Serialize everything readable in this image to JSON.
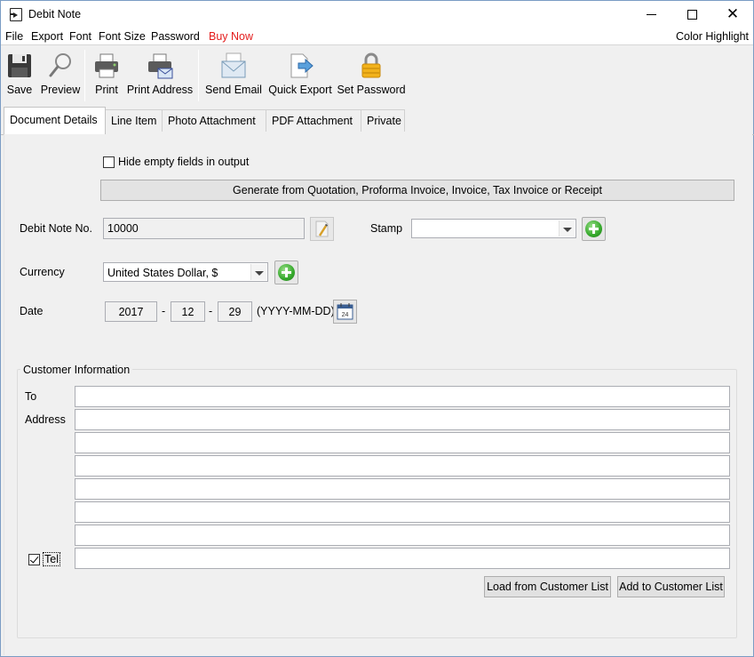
{
  "window": {
    "title": "Debit Note"
  },
  "menu": {
    "file": "File",
    "export": "Export",
    "font": "Font",
    "font_size": "Font Size",
    "password": "Password",
    "buy_now": "Buy Now",
    "color_highlight": "Color Highlight"
  },
  "toolbar": {
    "save": "Save",
    "preview": "Preview",
    "print": "Print",
    "print_address": "Print Address",
    "send_email": "Send Email",
    "quick_export": "Quick Export",
    "set_password": "Set Password"
  },
  "tabs": [
    {
      "label": "Document Details",
      "active": true
    },
    {
      "label": "Line Item"
    },
    {
      "label": "Photo Attachment"
    },
    {
      "label": "PDF Attachment"
    },
    {
      "label": "Private"
    }
  ],
  "form": {
    "hide_empty_label": "Hide empty fields in output",
    "generate_label": "Generate from Quotation, Proforma Invoice, Invoice, Tax Invoice or Receipt",
    "debit_note_no_label": "Debit Note No.",
    "debit_note_no_value": "10000",
    "stamp_label": "Stamp",
    "stamp_value": "",
    "currency_label": "Currency",
    "currency_value": "United States Dollar, $",
    "date_label": "Date",
    "date_year": "2017",
    "date_month": "12",
    "date_day": "29",
    "date_sep": "-",
    "date_format": "(YYYY-MM-DD)"
  },
  "customer": {
    "group_title": "Customer Information",
    "to_label": "To",
    "address_label": "Address",
    "tel_label": "Tel",
    "tel_checked": true,
    "load_button": "Load from Customer List",
    "add_button": "Add to Customer List"
  },
  "colors": {
    "buy_now": "#e31c1c",
    "add_green": "#34a82a"
  }
}
